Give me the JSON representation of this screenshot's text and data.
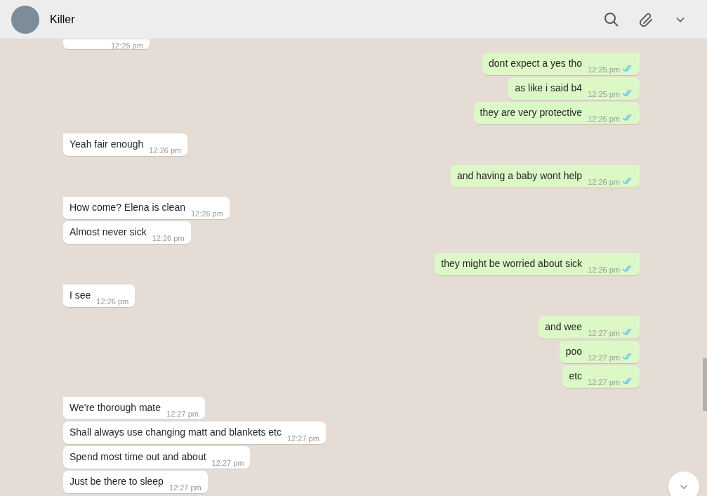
{
  "header": {
    "title": "Killer"
  },
  "groups": [
    {
      "kind": "incoming",
      "messages": [
        {
          "time": "12:25 pm"
        }
      ]
    },
    {
      "kind": "outgoing",
      "messages": [
        {
          "text": "dont expect a yes tho",
          "time": "12:25 pm",
          "read": true
        },
        {
          "text": "as like i said b4",
          "time": "12:25 pm",
          "read": true
        },
        {
          "text": "they are very protective",
          "time": "12:26 pm",
          "read": true
        }
      ]
    },
    {
      "kind": "incoming",
      "messages": [
        {
          "text": "Yeah fair enough",
          "time": "12:26 pm"
        }
      ]
    },
    {
      "kind": "outgoing",
      "messages": [
        {
          "text": "and having a baby wont help",
          "time": "12:26 pm",
          "read": true
        }
      ]
    },
    {
      "kind": "incoming",
      "messages": [
        {
          "text": "How come? Elena is clean",
          "time": "12:26 pm"
        },
        {
          "text": "Almost never sick",
          "time": "12:26 pm"
        }
      ]
    },
    {
      "kind": "outgoing",
      "messages": [
        {
          "text": "they might be worried about sick",
          "time": "12:26 pm",
          "read": true
        }
      ]
    },
    {
      "kind": "incoming",
      "messages": [
        {
          "text": "I see",
          "time": "12:26 pm"
        }
      ]
    },
    {
      "kind": "outgoing",
      "messages": [
        {
          "text": "and wee",
          "time": "12:27 pm",
          "read": true
        },
        {
          "text": "poo",
          "time": "12:27 pm",
          "read": true
        },
        {
          "text": "etc",
          "time": "12:27 pm",
          "read": true
        }
      ]
    },
    {
      "kind": "incoming",
      "messages": [
        {
          "text": "We're thorough mate",
          "time": "12:27 pm"
        },
        {
          "text": "Shall always use changing matt and blankets etc",
          "time": "12:27 pm"
        },
        {
          "text": "Spend most time out and about",
          "time": "12:27 pm"
        },
        {
          "text": "Just be there to sleep",
          "time": "12:27 pm"
        }
      ]
    }
  ]
}
